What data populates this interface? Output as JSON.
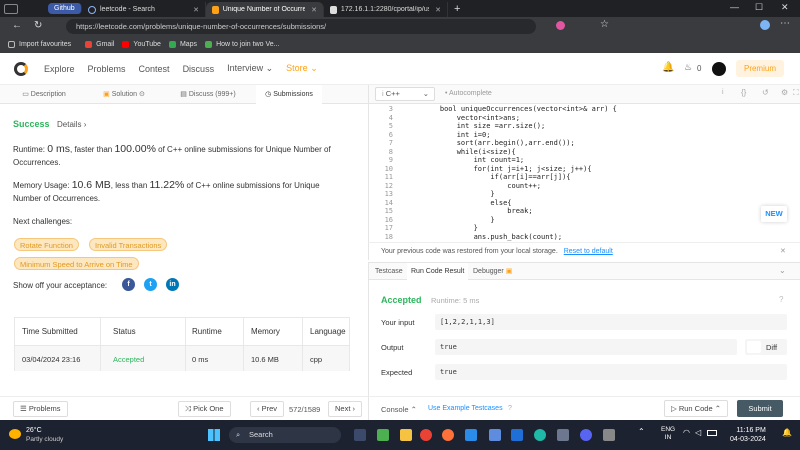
{
  "browser": {
    "tabs": [
      {
        "label": "Github"
      },
      {
        "label": "leetcode - Search"
      },
      {
        "label": "Unique Number of Occurrences"
      },
      {
        "label": "172.16.1.1:2280/cportal/ip/user..."
      }
    ],
    "url": "https://leetcode.com/problems/unique-number-of-occurrences/submissions/",
    "bookmarks": [
      "Import favourites",
      "Gmail",
      "YouTube",
      "Maps",
      "How to join two Ve..."
    ]
  },
  "nav": {
    "links": [
      "Explore",
      "Problems",
      "Contest",
      "Discuss",
      "Interview",
      "Store"
    ],
    "premium": "Premium",
    "coins": "0"
  },
  "left_tabs": [
    "Description",
    "Solution",
    "Discuss (999+)",
    "Submissions"
  ],
  "result": {
    "status": "Success",
    "details": "Details",
    "runtime_prefix": "Runtime: ",
    "runtime_value": "0 ms",
    "runtime_mid": ", faster than ",
    "runtime_pct": "100.00%",
    "runtime_suffix": " of C++ online submissions for Unique Number of Occurrences.",
    "memory_prefix": "Memory Usage: ",
    "memory_value": "10.6 MB",
    "memory_mid": ", less than ",
    "memory_pct": "11.22%",
    "memory_suffix": " of C++ online submissions for Unique Number of Occurrences.",
    "next_challenges_label": "Next challenges:",
    "challenges": [
      "Rotate Function",
      "Invalid Transactions",
      "Minimum Speed to Arrive on Time"
    ],
    "share_label": "Show off your acceptance:"
  },
  "table": {
    "headers": [
      "Time Submitted",
      "Status",
      "Runtime",
      "Memory",
      "Language"
    ],
    "row": [
      "03/04/2024 23:16",
      "Accepted",
      "0 ms",
      "10.6 MB",
      "cpp"
    ]
  },
  "left_footer": {
    "problems": "Problems",
    "pick_one": "Pick One",
    "prev": "Prev",
    "page": "572/1589",
    "next": "Next"
  },
  "editor": {
    "language": "C++",
    "autocomplete": "Autocomplete",
    "lines": [
      {
        "n": "3",
        "code": "    bool uniqueOccurrences(vector<int>& arr) {"
      },
      {
        "n": "4",
        "code": "        vector<int>ans;"
      },
      {
        "n": "5",
        "code": "        int size =arr.size();"
      },
      {
        "n": "6",
        "code": "        int i=0;"
      },
      {
        "n": "7",
        "code": "        sort(arr.begin(),arr.end());"
      },
      {
        "n": "8",
        "code": "        while(i<size){"
      },
      {
        "n": "9",
        "code": "            int count=1;"
      },
      {
        "n": "10",
        "code": "            for(int j=i+1; j<size; j++){"
      },
      {
        "n": "11",
        "code": "                if(arr[i]==arr[j]){"
      },
      {
        "n": "12",
        "code": "                    count++;"
      },
      {
        "n": "13",
        "code": "                }"
      },
      {
        "n": "14",
        "code": "                else{"
      },
      {
        "n": "15",
        "code": "                    break;"
      },
      {
        "n": "16",
        "code": "                }"
      },
      {
        "n": "17",
        "code": "            }"
      },
      {
        "n": "18",
        "code": "            ans.push_back(count);"
      }
    ],
    "restore_notice": "Your previous code was restored from your local storage.",
    "reset_link": "Reset to default",
    "new_badge": "NEW"
  },
  "result_tabs": [
    "Testcase",
    "Run Code Result",
    "Debugger"
  ],
  "run_result": {
    "status": "Accepted",
    "runtime": "Runtime: 5 ms",
    "input_label": "Your input",
    "input": "[1,2,2,1,1,3]",
    "output_label": "Output",
    "output": "true",
    "expected_label": "Expected",
    "expected": "true",
    "diff": "Diff"
  },
  "right_footer": {
    "console": "Console",
    "example": "Use Example Testcases",
    "run": "Run Code",
    "submit": "Submit"
  },
  "taskbar": {
    "temp": "26°C",
    "weather": "Partly cloudy",
    "search": "Search",
    "lang1": "ENG",
    "lang2": "IN",
    "time": "11:16 PM",
    "date": "04-03-2024"
  },
  "colors": {
    "accent": "#ffa116",
    "success": "#2db55d",
    "link": "#1a90ff"
  }
}
